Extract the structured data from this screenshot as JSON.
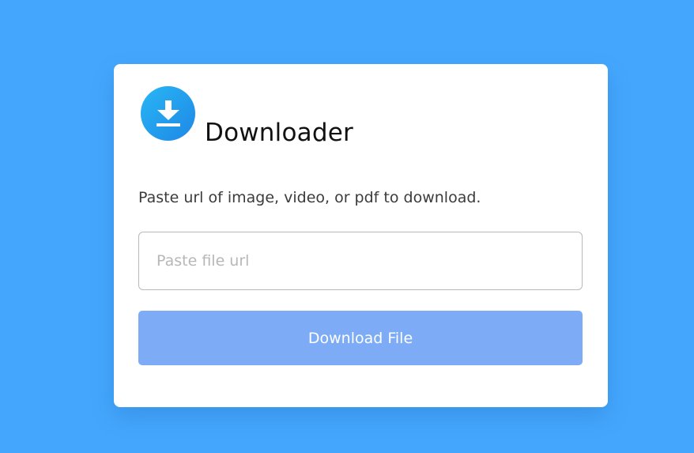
{
  "app": {
    "title": "Downloader",
    "description": "Paste url of image, video, or pdf to download.",
    "logo_icon": "download-icon"
  },
  "form": {
    "url_placeholder": "Paste file url",
    "url_value": "",
    "button_label": "Download File"
  },
  "colors": {
    "background": "#44a7fd",
    "card": "#ffffff",
    "button": "#7dabf6",
    "logo_gradient_start": "#29b6f6",
    "logo_gradient_end": "#1e88e5"
  }
}
